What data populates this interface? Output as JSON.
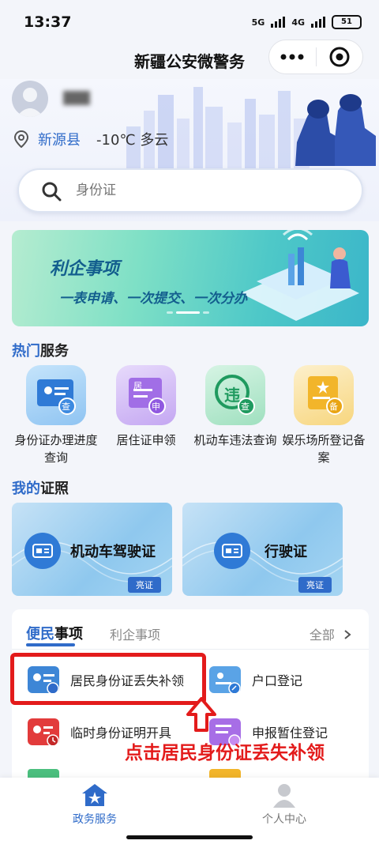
{
  "status": {
    "time": "13:37",
    "network": "5G",
    "network2": "4G",
    "battery": "51"
  },
  "header": {
    "title": "新疆公安微警务"
  },
  "user": {
    "location": "新源县",
    "weather": "-10℃ 多云"
  },
  "search": {
    "placeholder": "身份证"
  },
  "banner": {
    "title": "利企事项",
    "subtitle": "一表申请、一次提交、一次分办"
  },
  "hot": {
    "title_hl": "热门",
    "title_rest": "服务",
    "items": [
      {
        "label": "身份证办理进度查询",
        "badge": "查"
      },
      {
        "label": "居住证申领",
        "badge": "申",
        "tag": "居"
      },
      {
        "label": "机动车违法查询",
        "badge": "查",
        "tag": "违"
      },
      {
        "label": "娱乐场所登记备案",
        "badge": "备"
      }
    ]
  },
  "certs": {
    "title_hl": "我的",
    "title_rest": "证照",
    "items": [
      {
        "label": "机动车驾驶证",
        "badge": "亮证"
      },
      {
        "label": "行驶证",
        "badge": "亮证"
      }
    ]
  },
  "services": {
    "tab_active_hl": "便民",
    "tab_active_rest": "事项",
    "tab_other": "利企事项",
    "all": "全部",
    "items": [
      {
        "label": "居民身份证丢失补领"
      },
      {
        "label": "户口登记"
      },
      {
        "label": "临时身份证明开具"
      },
      {
        "label": "申报暂住登记"
      }
    ]
  },
  "annotation": "点击居民身份证丢失补领",
  "tabbar": {
    "home": "政务服务",
    "profile": "个人中心"
  },
  "colors": {
    "primary": "#2f6bc9",
    "annotation": "#e31b1b"
  }
}
